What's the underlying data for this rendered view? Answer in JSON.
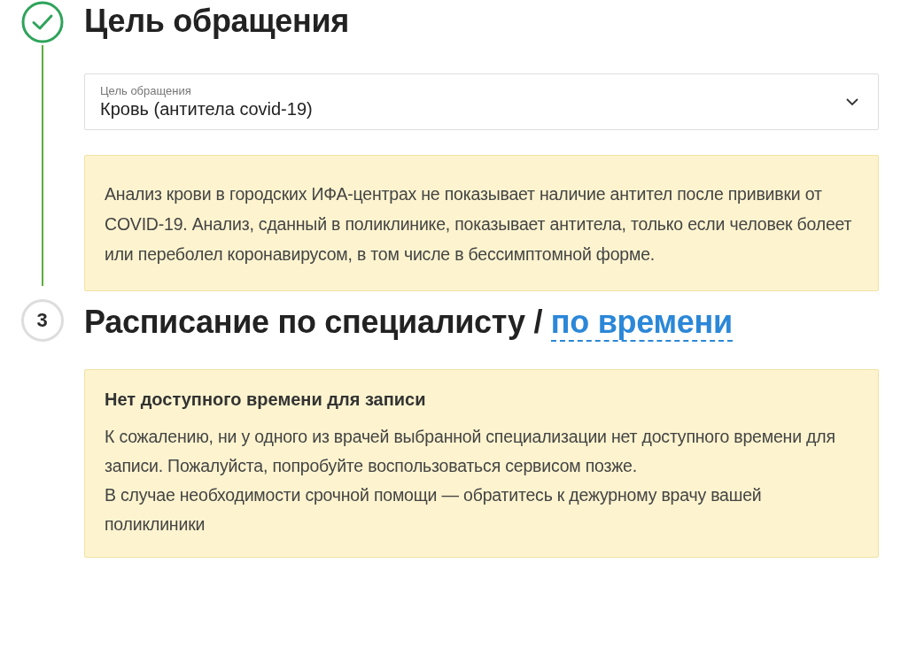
{
  "goal_section": {
    "completed": true,
    "title": "Цель обращения",
    "select": {
      "label": "Цель обращения",
      "value": "Кровь (антитела covid-19)"
    },
    "notice": "Анализ крови в городских ИФА-центрах не показывает наличие антител после прививки от COVID-19. Анализ, сданный в поликлинике, показывает антитела, только если человек болеет или переболел коронавирусом, в том числе в бессимптомной форме."
  },
  "schedule_section": {
    "completed": false,
    "number": "3",
    "title": "Расписание по специалисту /",
    "link": "по времени",
    "notice_title": "Нет доступного времени для записи",
    "notice_paragraphs": [
      "К сожалению, ни у одного из врачей выбранной специализации нет доступного времени для записи. Пожалуйста, попробуйте воспользоваться сервисом позже.",
      "В случае необходимости срочной помощи — обратитесь к дежурному врачу вашей поликлиники"
    ]
  }
}
